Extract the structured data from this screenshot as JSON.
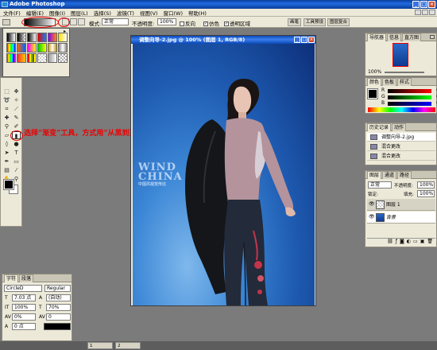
{
  "app": {
    "title": "Adobe Photoshop"
  },
  "menubar": {
    "items": [
      "文件(F)",
      "编辑(E)",
      "图像(I)",
      "图层(L)",
      "选择(S)",
      "滤镜(T)",
      "视图(V)",
      "窗口(W)",
      "帮助(H)"
    ]
  },
  "options": {
    "mode_label": "模式:",
    "mode_value": "正常",
    "opacity_label": "不透明度:",
    "opacity_value": "100%",
    "reverse_label": "反向",
    "dither_label": "仿色",
    "transparency_label": "透明区域",
    "well_tabs": [
      "画笔",
      "工具预设",
      "图层复合"
    ]
  },
  "document": {
    "title": "调整向导-2.jpg @ 100% (图层 1, RGB/8)",
    "watermark_big": "WIND",
    "watermark_big2": "CHINA",
    "watermark_small": "中国风视觉传达"
  },
  "annotation": {
    "text": "选择“渐变”工具，方式用“从黑到透明”"
  },
  "navigator": {
    "tabs": [
      "导航器",
      "信息",
      "直方图"
    ],
    "zoom": "100%"
  },
  "colorpanel": {
    "tabs": [
      "颜色",
      "色板",
      "样式"
    ],
    "channels": [
      {
        "label": "R",
        "value": "0"
      },
      {
        "label": "G",
        "value": "0"
      },
      {
        "label": "B",
        "value": "0"
      }
    ]
  },
  "history": {
    "tabs": [
      "历史记录",
      "动作"
    ],
    "items": [
      "调整向导-2.jpg",
      "混合更改",
      "混合更改"
    ]
  },
  "layers": {
    "tabs": [
      "图层",
      "通道",
      "路径"
    ],
    "blend_mode": "正常",
    "opacity_label": "不透明度:",
    "opacity_value": "100%",
    "lock_label": "锁定:",
    "fill_label": "填充:",
    "fill_value": "100%",
    "items": [
      "图层 1",
      "背景"
    ]
  },
  "character": {
    "tabs": [
      "字符",
      "段落"
    ],
    "font": "CircleD",
    "style": "Regular",
    "size": "7.03 点",
    "leading": "(自动)",
    "vscale": "100%",
    "hscale": "70%",
    "tracking": "0%",
    "baseline": "0",
    "baseline_unit": "点",
    "kern": "0"
  },
  "taskbar": {
    "items": [
      "1",
      "2"
    ]
  },
  "colors": {
    "accent": "#0a3e9b",
    "annotation": "#ee0000",
    "panel": "#ece9d8"
  }
}
